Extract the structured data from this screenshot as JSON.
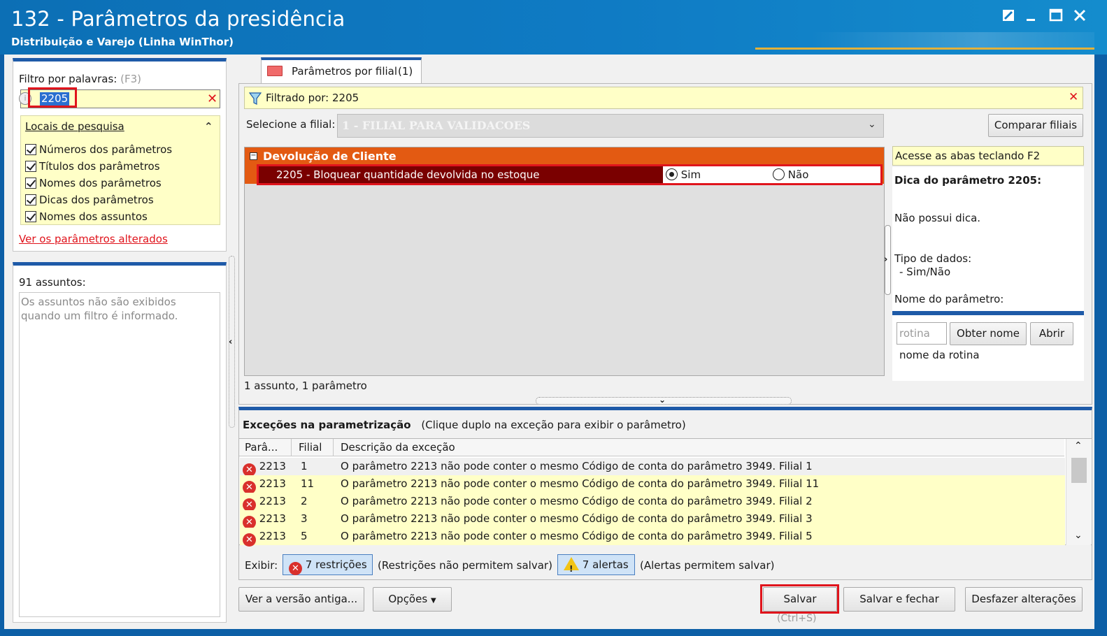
{
  "window": {
    "title": "132 - Parâmetros da presidência",
    "subtitle": "Distribuição e Varejo (Linha WinThor)"
  },
  "filter": {
    "label": "Filtro por palavras:",
    "shortcut": "(F3)",
    "value": "2205"
  },
  "search_locations": {
    "title": "Locais de pesquisa",
    "items": [
      {
        "label": "Números dos parâmetros",
        "checked": true
      },
      {
        "label": "Títulos dos parâmetros",
        "checked": true
      },
      {
        "label": "Nomes dos parâmetros",
        "checked": true
      },
      {
        "label": "Dicas dos parâmetros",
        "checked": true
      },
      {
        "label": "Nomes dos assuntos",
        "checked": true
      }
    ],
    "changed_link": "Ver os parâmetros alterados"
  },
  "subjects": {
    "count_label": "91 assuntos:",
    "empty_message": "Os assuntos não são exibidos quando um filtro é informado."
  },
  "tab": {
    "label": "Parâmetros por filial",
    "count": "(1)"
  },
  "filtered_by": "Filtrado por: 2205",
  "branch": {
    "label": "Selecione a filial:",
    "value": "1 - FILIAL PARA VALIDACOES",
    "compare_button": "Comparar filiais"
  },
  "group": {
    "title": "Devolução de Cliente",
    "parameter": {
      "label": "2205 - Bloquear quantidade devolvida no estoque",
      "option_yes": "Sim",
      "option_no": "Não",
      "selected": "Sim"
    }
  },
  "summary": "1 assunto, 1 parâmetro",
  "hint": {
    "tabs_hint": "Acesse as abas teclando F2",
    "title": "Dica do parâmetro 2205:",
    "text": "Não possui dica.",
    "data_type_label": "Tipo de dados:",
    "data_type_value": "- Sim/Não",
    "param_name_label": "Nome do parâmetro:",
    "routine_placeholder": "rotina",
    "get_name_button": "Obter nome",
    "open_button": "Abrir",
    "routine_name": "nome da rotina"
  },
  "exceptions": {
    "title": "Exceções na parametrização",
    "subtitle": "(Clique duplo na exceção para exibir o parâmetro)",
    "columns": [
      "Parâ...",
      "Filial",
      "Descrição da exceção"
    ],
    "rows": [
      {
        "param": "2213",
        "filial": "1",
        "desc": "O parâmetro 2213 não pode conter o mesmo Código de conta do parâmetro 3949. Filial 1"
      },
      {
        "param": "2213",
        "filial": "11",
        "desc": "O parâmetro 2213 não pode conter o mesmo Código de conta do parâmetro 3949. Filial 11"
      },
      {
        "param": "2213",
        "filial": "2",
        "desc": "O parâmetro 2213 não pode conter o mesmo Código de conta do parâmetro 3949. Filial 2"
      },
      {
        "param": "2213",
        "filial": "3",
        "desc": "O parâmetro 2213 não pode conter o mesmo Código de conta do parâmetro 3949. Filial 3"
      },
      {
        "param": "2213",
        "filial": "5",
        "desc": "O parâmetro 2213 não pode conter o mesmo Código de conta do parâmetro 3949. Filial 5"
      }
    ],
    "show_label": "Exibir:",
    "restrictions_button": "7 restrições",
    "restrictions_note": "(Restrições não permitem salvar)",
    "alerts_button": "7 alertas",
    "alerts_note": "(Alertas permitem salvar)"
  },
  "footer": {
    "old_version_button": "Ver a versão antiga...",
    "options_button": "Opções",
    "save_button": "Salvar",
    "save_shortcut": "(Ctrl+S)",
    "save_close_button": "Salvar e fechar",
    "undo_button": "Desfazer alterações"
  },
  "colors": {
    "accent_blue": "#1e5aa8",
    "group_header": "#e35a12",
    "selected_row": "#7a0000",
    "highlight_box": "#e0141c",
    "hint_yellow": "#ffffc7"
  }
}
